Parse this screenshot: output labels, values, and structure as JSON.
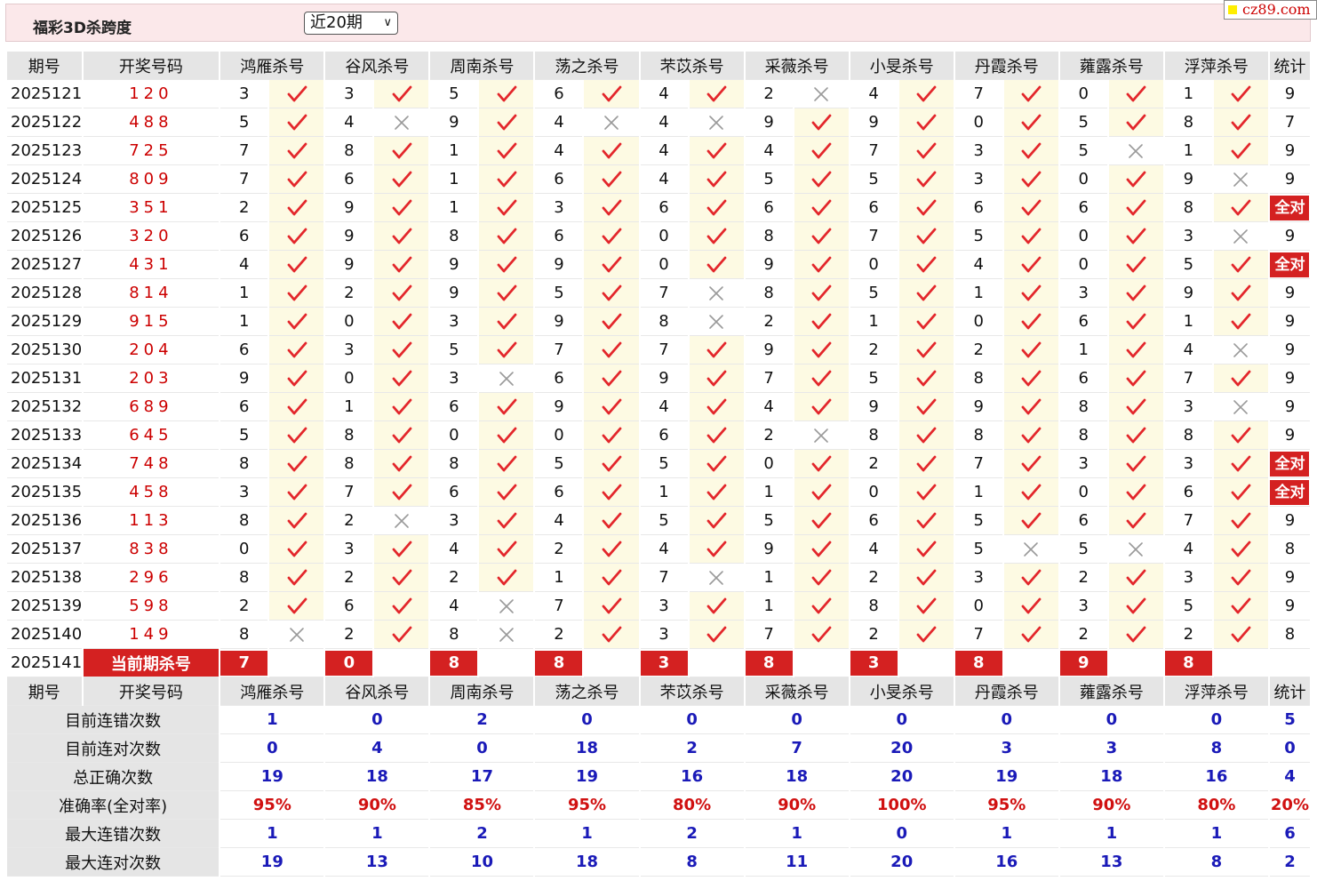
{
  "header": {
    "title": "福彩3D杀跨度",
    "period_select": "近20期",
    "site_logo": "cz89.com"
  },
  "columns": {
    "issue": "期号",
    "draw": "开奖号码",
    "experts": [
      "鸿雁杀号",
      "谷风杀号",
      "周南杀号",
      "荡之杀号",
      "芣苡杀号",
      "采薇杀号",
      "小旻杀号",
      "丹霞杀号",
      "蕹露杀号",
      "浮萍杀号"
    ],
    "stat": "统计"
  },
  "all_correct_label": "全对",
  "rows": [
    {
      "issue": "2025121",
      "draw": "120",
      "kills": [
        3,
        3,
        5,
        6,
        4,
        2,
        4,
        7,
        0,
        1
      ],
      "ok": [
        1,
        1,
        1,
        1,
        1,
        0,
        1,
        1,
        1,
        1
      ],
      "stat": "9"
    },
    {
      "issue": "2025122",
      "draw": "488",
      "kills": [
        5,
        4,
        9,
        4,
        4,
        9,
        9,
        0,
        5,
        8
      ],
      "ok": [
        1,
        0,
        1,
        0,
        0,
        1,
        1,
        1,
        1,
        1
      ],
      "stat": "7"
    },
    {
      "issue": "2025123",
      "draw": "725",
      "kills": [
        7,
        8,
        1,
        4,
        4,
        4,
        7,
        3,
        5,
        1
      ],
      "ok": [
        1,
        1,
        1,
        1,
        1,
        1,
        1,
        1,
        0,
        1
      ],
      "stat": "9"
    },
    {
      "issue": "2025124",
      "draw": "809",
      "kills": [
        7,
        6,
        1,
        6,
        4,
        5,
        5,
        3,
        0,
        9
      ],
      "ok": [
        1,
        1,
        1,
        1,
        1,
        1,
        1,
        1,
        1,
        0
      ],
      "stat": "9"
    },
    {
      "issue": "2025125",
      "draw": "351",
      "kills": [
        2,
        9,
        1,
        3,
        6,
        6,
        6,
        6,
        6,
        8
      ],
      "ok": [
        1,
        1,
        1,
        1,
        1,
        1,
        1,
        1,
        1,
        1
      ],
      "stat": "全对"
    },
    {
      "issue": "2025126",
      "draw": "320",
      "kills": [
        6,
        9,
        8,
        6,
        0,
        8,
        7,
        5,
        0,
        3
      ],
      "ok": [
        1,
        1,
        1,
        1,
        1,
        1,
        1,
        1,
        1,
        0
      ],
      "stat": "9"
    },
    {
      "issue": "2025127",
      "draw": "431",
      "kills": [
        4,
        9,
        9,
        9,
        0,
        9,
        0,
        4,
        0,
        5
      ],
      "ok": [
        1,
        1,
        1,
        1,
        1,
        1,
        1,
        1,
        1,
        1
      ],
      "stat": "全对"
    },
    {
      "issue": "2025128",
      "draw": "814",
      "kills": [
        1,
        2,
        9,
        5,
        7,
        8,
        5,
        1,
        3,
        9
      ],
      "ok": [
        1,
        1,
        1,
        1,
        0,
        1,
        1,
        1,
        1,
        1
      ],
      "stat": "9"
    },
    {
      "issue": "2025129",
      "draw": "915",
      "kills": [
        1,
        0,
        3,
        9,
        8,
        2,
        1,
        0,
        6,
        1
      ],
      "ok": [
        1,
        1,
        1,
        1,
        0,
        1,
        1,
        1,
        1,
        1
      ],
      "stat": "9"
    },
    {
      "issue": "2025130",
      "draw": "204",
      "kills": [
        6,
        3,
        5,
        7,
        7,
        9,
        2,
        2,
        1,
        4
      ],
      "ok": [
        1,
        1,
        1,
        1,
        1,
        1,
        1,
        1,
        1,
        0
      ],
      "stat": "9"
    },
    {
      "issue": "2025131",
      "draw": "203",
      "kills": [
        9,
        0,
        3,
        6,
        9,
        7,
        5,
        8,
        6,
        7
      ],
      "ok": [
        1,
        1,
        0,
        1,
        1,
        1,
        1,
        1,
        1,
        1
      ],
      "stat": "9"
    },
    {
      "issue": "2025132",
      "draw": "689",
      "kills": [
        6,
        1,
        6,
        9,
        4,
        4,
        9,
        9,
        8,
        3
      ],
      "ok": [
        1,
        1,
        1,
        1,
        1,
        1,
        1,
        1,
        1,
        0
      ],
      "stat": "9"
    },
    {
      "issue": "2025133",
      "draw": "645",
      "kills": [
        5,
        8,
        0,
        0,
        6,
        2,
        8,
        8,
        8,
        8
      ],
      "ok": [
        1,
        1,
        1,
        1,
        1,
        0,
        1,
        1,
        1,
        1
      ],
      "stat": "9"
    },
    {
      "issue": "2025134",
      "draw": "748",
      "kills": [
        8,
        8,
        8,
        5,
        5,
        0,
        2,
        7,
        3,
        3
      ],
      "ok": [
        1,
        1,
        1,
        1,
        1,
        1,
        1,
        1,
        1,
        1
      ],
      "stat": "全对"
    },
    {
      "issue": "2025135",
      "draw": "458",
      "kills": [
        3,
        7,
        6,
        6,
        1,
        1,
        0,
        1,
        0,
        6
      ],
      "ok": [
        1,
        1,
        1,
        1,
        1,
        1,
        1,
        1,
        1,
        1
      ],
      "stat": "全对"
    },
    {
      "issue": "2025136",
      "draw": "113",
      "kills": [
        8,
        2,
        3,
        4,
        5,
        5,
        6,
        5,
        6,
        7
      ],
      "ok": [
        1,
        0,
        1,
        1,
        1,
        1,
        1,
        1,
        1,
        1
      ],
      "stat": "9"
    },
    {
      "issue": "2025137",
      "draw": "838",
      "kills": [
        0,
        3,
        4,
        2,
        4,
        9,
        4,
        5,
        5,
        4
      ],
      "ok": [
        1,
        1,
        1,
        1,
        1,
        1,
        1,
        0,
        0,
        1
      ],
      "stat": "8"
    },
    {
      "issue": "2025138",
      "draw": "296",
      "kills": [
        8,
        2,
        2,
        1,
        7,
        1,
        2,
        3,
        2,
        3
      ],
      "ok": [
        1,
        1,
        1,
        1,
        0,
        1,
        1,
        1,
        1,
        1
      ],
      "stat": "9"
    },
    {
      "issue": "2025139",
      "draw": "598",
      "kills": [
        2,
        6,
        4,
        7,
        3,
        1,
        8,
        0,
        3,
        5
      ],
      "ok": [
        1,
        1,
        0,
        1,
        1,
        1,
        1,
        1,
        1,
        1
      ],
      "stat": "9"
    },
    {
      "issue": "2025140",
      "draw": "149",
      "kills": [
        8,
        2,
        8,
        2,
        3,
        7,
        2,
        7,
        2,
        2
      ],
      "ok": [
        0,
        1,
        0,
        1,
        1,
        1,
        1,
        1,
        1,
        1
      ],
      "stat": "8"
    }
  ],
  "current": {
    "issue": "2025141",
    "label": "当前期杀号",
    "kills": [
      7,
      0,
      8,
      8,
      3,
      8,
      3,
      8,
      9,
      8
    ]
  },
  "summary": [
    {
      "label": "目前连错次数",
      "values": [
        "1",
        "0",
        "2",
        "0",
        "0",
        "0",
        "0",
        "0",
        "0",
        "0"
      ],
      "stat": "5",
      "pct": false
    },
    {
      "label": "目前连对次数",
      "values": [
        "0",
        "4",
        "0",
        "18",
        "2",
        "7",
        "20",
        "3",
        "3",
        "8"
      ],
      "stat": "0",
      "pct": false
    },
    {
      "label": "总正确次数",
      "values": [
        "19",
        "18",
        "17",
        "19",
        "16",
        "18",
        "20",
        "19",
        "18",
        "16"
      ],
      "stat": "4",
      "pct": false
    },
    {
      "label": "准确率(全对率)",
      "values": [
        "95%",
        "90%",
        "85%",
        "95%",
        "80%",
        "90%",
        "100%",
        "95%",
        "90%",
        "80%"
      ],
      "stat": "20%",
      "pct": true
    },
    {
      "label": "最大连错次数",
      "values": [
        "1",
        "1",
        "2",
        "1",
        "2",
        "1",
        "0",
        "1",
        "1",
        "1"
      ],
      "stat": "6",
      "pct": false
    },
    {
      "label": "最大连对次数",
      "values": [
        "19",
        "13",
        "10",
        "18",
        "8",
        "11",
        "20",
        "16",
        "13",
        "8"
      ],
      "stat": "2",
      "pct": false
    }
  ],
  "colors": {
    "correct": "#e3262b",
    "wrong": "#9a9a9a",
    "highlight": "#d42121",
    "summary_blue": "#1a1ab8"
  }
}
